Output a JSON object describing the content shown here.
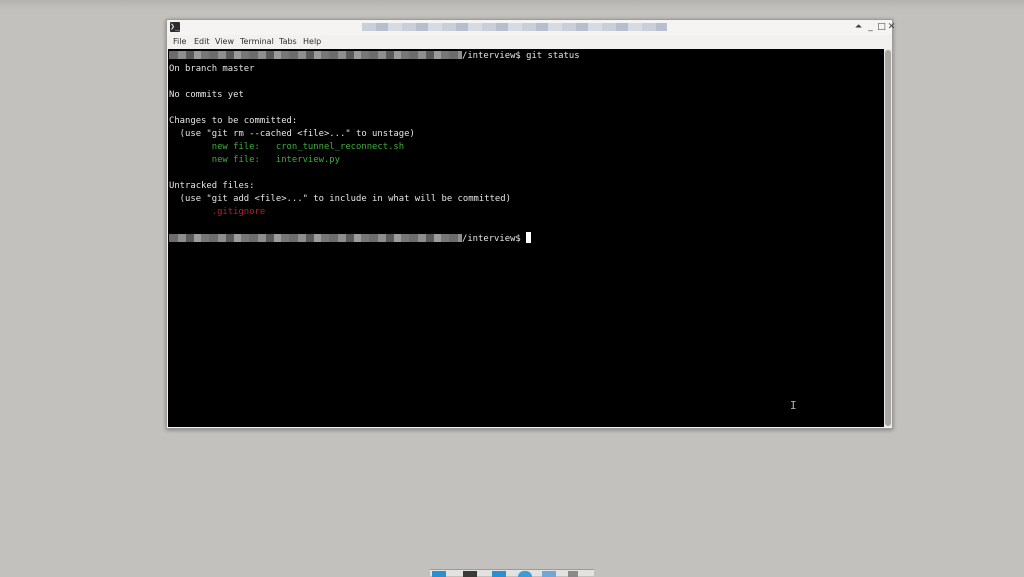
{
  "window": {
    "app_icon_glyph": "❯_",
    "title": "",
    "controls": {
      "up": "⏶",
      "minimize": "_",
      "maximize": "□",
      "close": "✕"
    }
  },
  "menu": {
    "items": [
      "File",
      "Edit",
      "View",
      "Terminal",
      "Tabs",
      "Help"
    ]
  },
  "terminal": {
    "prompt_suffix": "/interview$",
    "command": " git status",
    "lines": {
      "branch": "On branch master",
      "no_commits": "No commits yet",
      "changes_header": "Changes to be committed:",
      "unstage_hint": "  (use \"git rm --cached <file>...\" to unstage)",
      "new_file_1": "        new file:   cron_tunnel_reconnect.sh",
      "new_file_2": "        new file:   interview.py",
      "untracked_header": "Untracked files:",
      "add_hint": "  (use \"git add <file>...\" to include in what will be committed)",
      "untracked_file": "        .gitignore"
    }
  },
  "colors": {
    "terminal_bg": "#000000",
    "terminal_fg": "#e6e6e6",
    "staged_green": "#3fae3a",
    "untracked_red": "#c01c28",
    "desktop_bg": "#c3c1be"
  },
  "icons": {
    "app": "terminal-icon",
    "pointer": "text-cursor-icon"
  }
}
